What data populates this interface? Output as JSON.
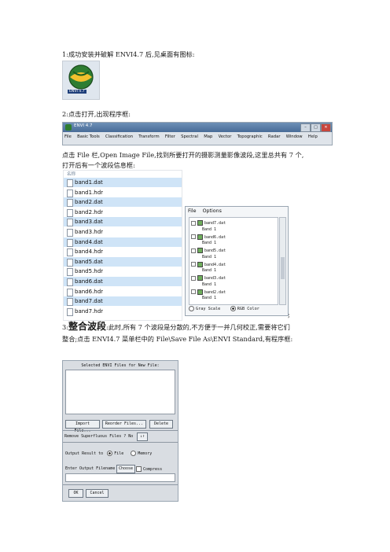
{
  "step1": {
    "text": "1:成功安装并破解 ENVI4.7 后,见桌面有图标:"
  },
  "desktop_icon": {
    "label": "ENVI 4.7",
    "name": "envi-app-icon"
  },
  "step2": {
    "text": "2:点击打开,出现程序框:"
  },
  "envi_window": {
    "title": "ENVI 4.7",
    "controls": [
      "–",
      "□",
      "✕"
    ],
    "menu": [
      "File",
      "Basic Tools",
      "Classification",
      "Transform",
      "Filter",
      "Spectral",
      "Map",
      "Vector",
      "Topographic",
      "Radar",
      "Window",
      "Help"
    ]
  },
  "step2_desc": {
    "line1": "点击 File 栏,Open Image File,找到所要打开的摄影测量影像波段,这里总共有 7 个,",
    "line2": "打开后有一个波段信息框:"
  },
  "file_list": {
    "header": "名称",
    "files": [
      {
        "name": "band1.dat",
        "selected": true
      },
      {
        "name": "band1.hdr",
        "selected": false
      },
      {
        "name": "band2.dat",
        "selected": true
      },
      {
        "name": "band2.hdr",
        "selected": false
      },
      {
        "name": "band3.dat",
        "selected": true
      },
      {
        "name": "band3.hdr",
        "selected": false
      },
      {
        "name": "band4.dat",
        "selected": true
      },
      {
        "name": "band4.hdr",
        "selected": false
      },
      {
        "name": "band5.dat",
        "selected": true
      },
      {
        "name": "band5.hdr",
        "selected": false
      },
      {
        "name": "band6.dat",
        "selected": true
      },
      {
        "name": "band6.hdr",
        "selected": false
      },
      {
        "name": "band7.dat",
        "selected": true
      },
      {
        "name": "band7.hdr",
        "selected": false
      }
    ]
  },
  "band_panel": {
    "menu": [
      "File",
      "Options"
    ],
    "tree": [
      {
        "label": "band7.dat",
        "child": "Band 1"
      },
      {
        "label": "band6.dat",
        "child": "Band 1"
      },
      {
        "label": "band5.dat",
        "child": "Band 1"
      },
      {
        "label": "band4.dat",
        "child": "Band 1"
      },
      {
        "label": "band3.dat",
        "child": "Band 1"
      },
      {
        "label": "band2.dat",
        "child": "Band 1"
      }
    ],
    "radio_gray": "Gray Scale",
    "radio_rgb": "RGB Color",
    "selected_mode": "RGB Color",
    "trailing": ";"
  },
  "step3": {
    "prefix": "3:",
    "bold": "整合波段",
    "line1": ":此时,所有  7  个波段是分散的,不方便于一并几何校正,需要将它们",
    "line2": "整合;点击 ENVI4.7 菜单栏中的 File\\Save File As\\ENVI Standard,有程序框:"
  },
  "dialog": {
    "title": "Selected ENVI Files for New File:",
    "import_label": "Import File...",
    "reorder_label": "Reorder Files...",
    "delete_label": "Delete",
    "remove_label": "Remove Superfluous Files ? No",
    "toggle_label": "↓↑",
    "output_label": "Output Result to",
    "file_option": "File",
    "memory_option": "Memory",
    "filename_label": "Enter Output Filename",
    "choose_label": "Choose",
    "compress_label": "Compress",
    "ok_label": "OK",
    "cancel_label": "Cancel"
  }
}
